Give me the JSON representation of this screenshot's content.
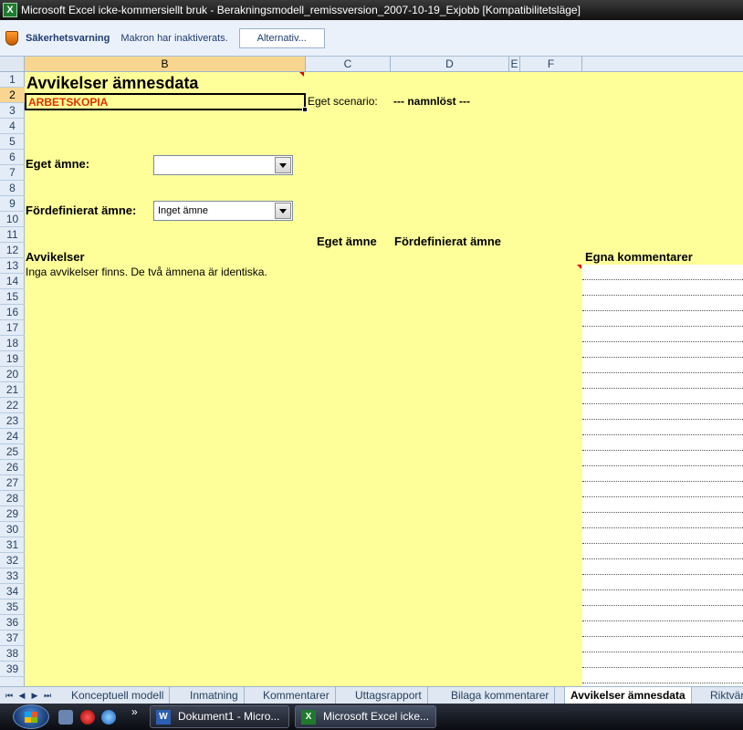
{
  "window": {
    "title": "Microsoft Excel icke-kommersiellt bruk - Berakningsmodell_remissversion_2007-10-19_Exjobb  [Kompatibilitetsläge]",
    "app_icon": "X"
  },
  "security_bar": {
    "title": "Säkerhetsvarning",
    "message": "Makron har inaktiverats.",
    "button": "Alternativ..."
  },
  "columns": [
    "B",
    "C",
    "D",
    "E",
    "F"
  ],
  "rows": [
    "1",
    "2",
    "3",
    "4",
    "5",
    "6",
    "7",
    "8",
    "9",
    "10",
    "11",
    "12",
    "13",
    "14",
    "15",
    "16",
    "17",
    "18",
    "19",
    "20",
    "21",
    "22",
    "23",
    "24",
    "25",
    "26",
    "27",
    "28",
    "29",
    "30",
    "31",
    "32",
    "33",
    "34",
    "35",
    "36",
    "37",
    "38",
    "39"
  ],
  "sheet": {
    "title": "Avvikelser ämnesdata",
    "working_copy": "ARBETSKOPIA",
    "scenario_label": "Eget scenario:",
    "scenario_value": "--- namnlöst ---",
    "own_subject_label": "Eget ämne:",
    "own_subject_value": "",
    "predefined_label": "Fördefinierat ämne:",
    "predefined_value": "Inget ämne",
    "col_own": "Eget ämne",
    "col_predefined": "Fördefinierat ämne",
    "deviations_label": "Avvikelser",
    "comments_label": "Egna kommentarer",
    "deviations_text": "Inga avvikelser finns. De två ämnena är identiska."
  },
  "tabs": [
    "Konceptuell modell",
    "Inmatning",
    "Kommentarer",
    "Uttagsrapport",
    "Bilaga kommentarer",
    "Avvikelser ämnesdata",
    "Riktvär"
  ],
  "active_tab": "Avvikelser ämnesdata",
  "taskbar": {
    "word_button": "Dokument1 - Micro...",
    "excel_button": "Microsoft Excel icke...",
    "more": "»",
    "word_icon": "W",
    "excel_icon": "X"
  }
}
